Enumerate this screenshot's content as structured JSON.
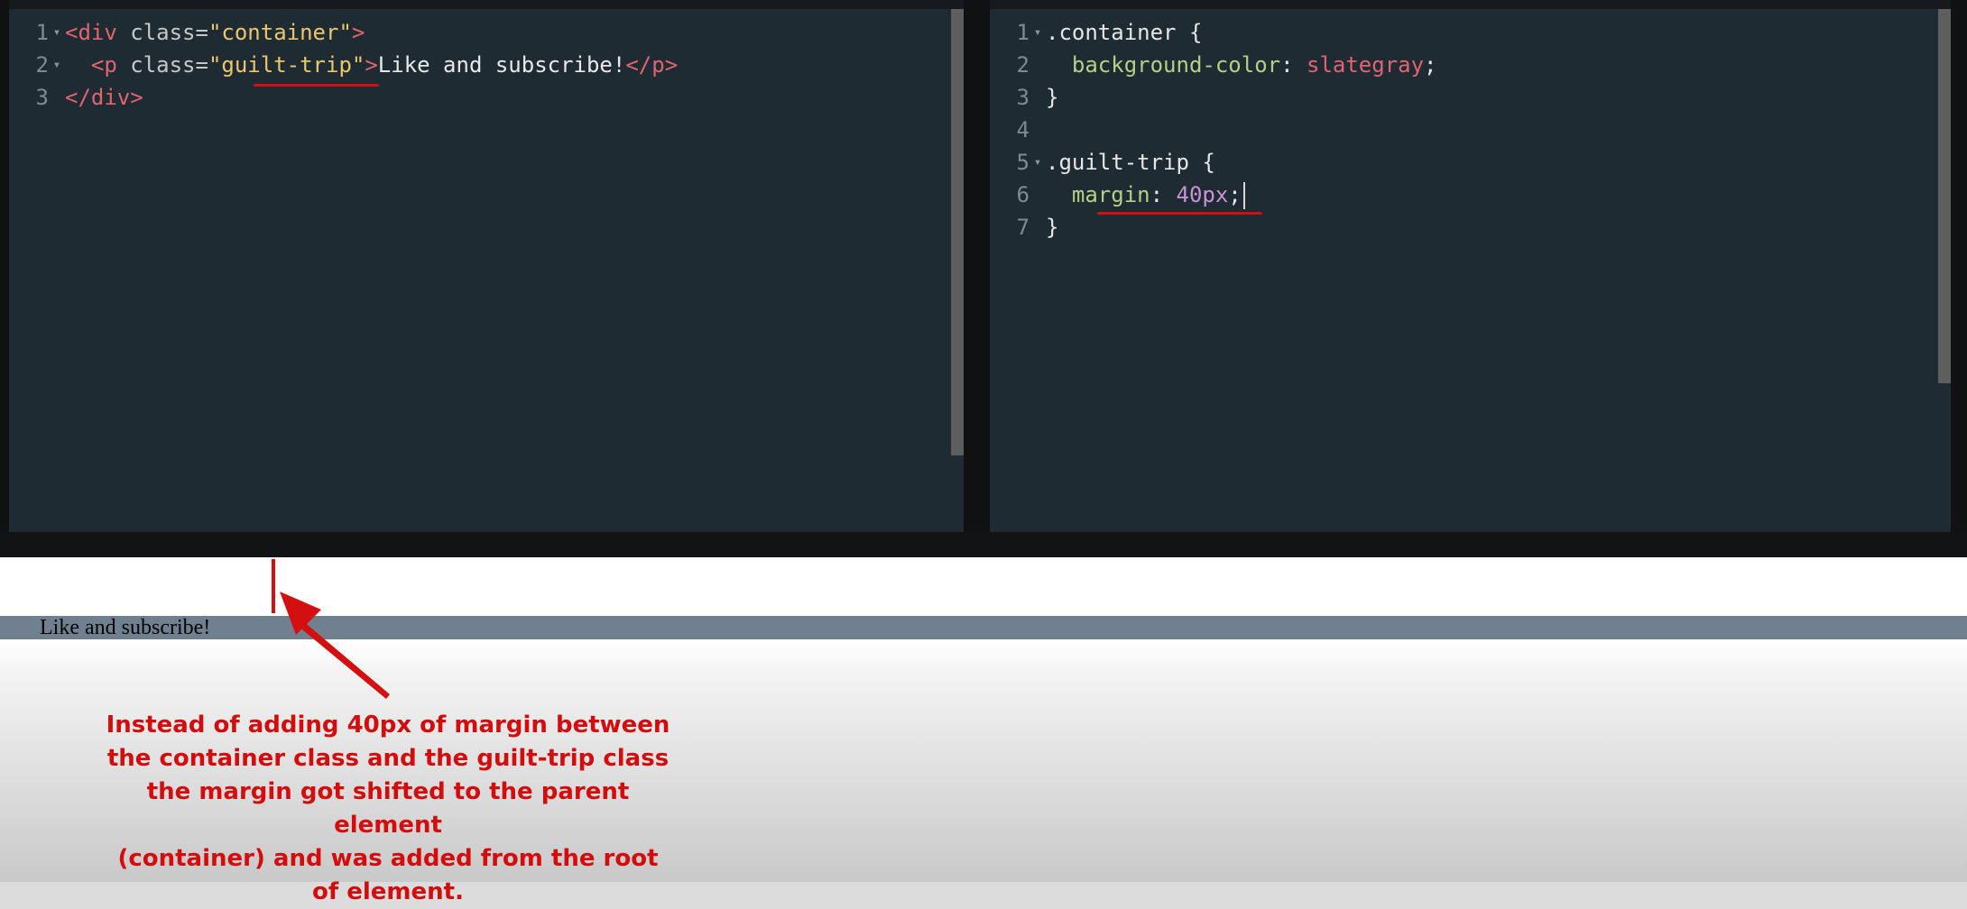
{
  "colors": {
    "editor_bg": "#1f2b33",
    "tag": "#e0646f",
    "attr": "#c7c7c7",
    "string": "#ecc66b",
    "text": "#e8e8e8",
    "selector": "#e6e6e6",
    "property": "#b5cf85",
    "value": "#e0646f",
    "number": "#c792d6",
    "annotation": "#d30d0d",
    "container_bg": "#708090"
  },
  "html_editor": {
    "lines": [
      {
        "n": "1",
        "fold": true,
        "tokens": [
          {
            "t": "<div ",
            "c": "tag"
          },
          {
            "t": "class=",
            "c": "attr"
          },
          {
            "t": "\"container\"",
            "c": "string"
          },
          {
            "t": ">",
            "c": "tag"
          }
        ]
      },
      {
        "n": "2",
        "fold": true,
        "tokens": [
          {
            "t": "  <p ",
            "c": "tag"
          },
          {
            "t": "class=",
            "c": "attr"
          },
          {
            "t": "\"guilt-trip\"",
            "c": "string"
          },
          {
            "t": ">",
            "c": "tag"
          },
          {
            "t": "Like and subscribe!",
            "c": "text"
          },
          {
            "t": "</p>",
            "c": "tag"
          }
        ]
      },
      {
        "n": "3",
        "fold": false,
        "tokens": [
          {
            "t": "</div>",
            "c": "tag"
          }
        ]
      }
    ]
  },
  "css_editor": {
    "lines": [
      {
        "n": "1",
        "fold": true,
        "tokens": [
          {
            "t": ".container {",
            "c": "selector"
          }
        ]
      },
      {
        "n": "2",
        "fold": false,
        "tokens": [
          {
            "t": "  background-color",
            "c": "property"
          },
          {
            "t": ": ",
            "c": "selector"
          },
          {
            "t": "slategray",
            "c": "value"
          },
          {
            "t": ";",
            "c": "selector"
          }
        ]
      },
      {
        "n": "3",
        "fold": false,
        "tokens": [
          {
            "t": "}",
            "c": "selector"
          }
        ]
      },
      {
        "n": "4",
        "fold": false,
        "tokens": []
      },
      {
        "n": "5",
        "fold": true,
        "tokens": [
          {
            "t": ".guilt-trip {",
            "c": "selector"
          }
        ]
      },
      {
        "n": "6",
        "fold": false,
        "cursor": true,
        "tokens": [
          {
            "t": "  margin",
            "c": "property"
          },
          {
            "t": ": ",
            "c": "selector"
          },
          {
            "t": "40px",
            "c": "number"
          },
          {
            "t": ";",
            "c": "selector"
          }
        ]
      },
      {
        "n": "7",
        "fold": false,
        "tokens": [
          {
            "t": "}",
            "c": "selector"
          }
        ]
      }
    ]
  },
  "preview": {
    "text": "Like and subscribe!"
  },
  "annotation": {
    "lines": [
      "Instead of adding 40px of margin between",
      "the container class and the guilt-trip class",
      "the margin got shifted to the parent element",
      "(container) and was added from the root",
      "of element."
    ]
  }
}
